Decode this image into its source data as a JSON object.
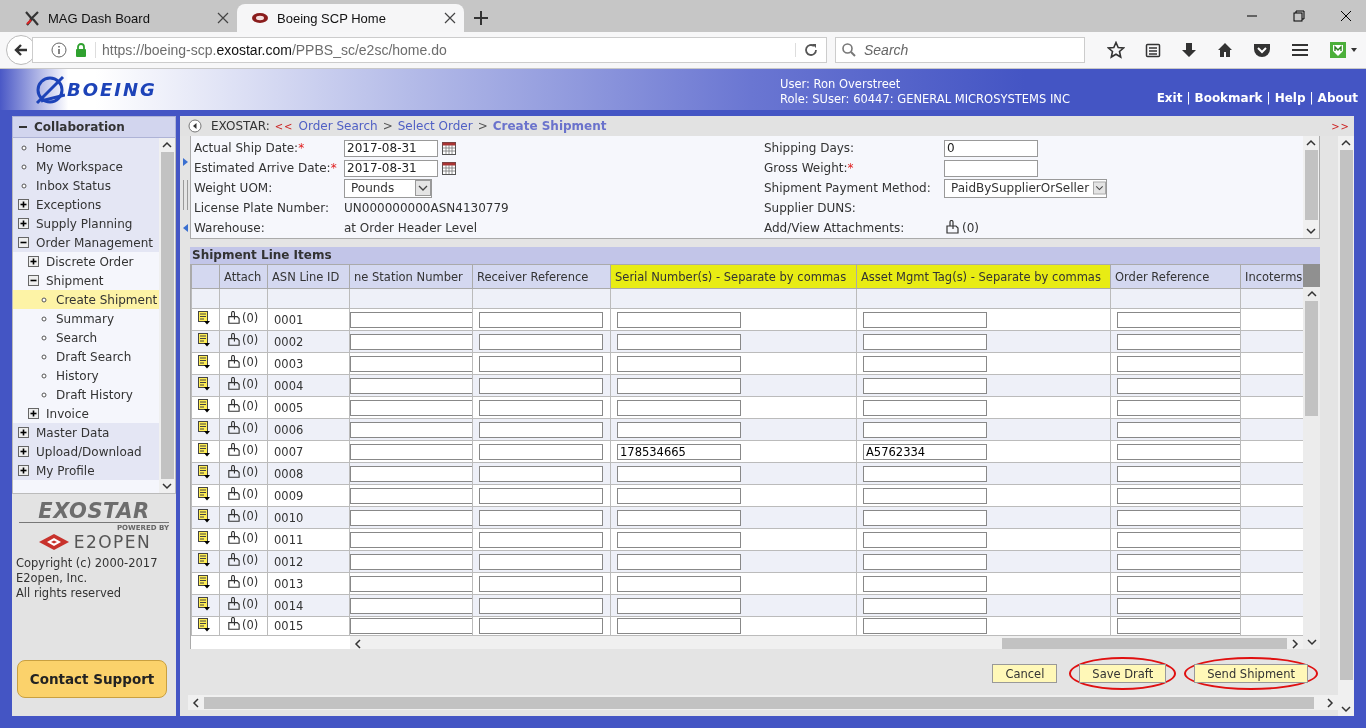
{
  "browser": {
    "tabs": [
      {
        "title": "MAG Dash Board",
        "selected": false
      },
      {
        "title": "Boeing SCP Home",
        "selected": true
      }
    ],
    "url": {
      "scheme_host": "https://boeing-scp.",
      "domain": "exostar.com",
      "path": "/PPBS_sc/e2sc/home.do"
    },
    "search": {
      "placeholder": "Search"
    }
  },
  "header": {
    "logo": "BOEING",
    "user": "User: Ron Overstreet",
    "role": "Role: SUser: 60447: GENERAL MICROSYSTEMS INC",
    "links": [
      {
        "kind": "link",
        "label": "Exit"
      },
      {
        "kind": "separator",
        "label": "|"
      },
      {
        "kind": "link",
        "label": "Bookmark"
      },
      {
        "kind": "separator",
        "label": "|"
      },
      {
        "kind": "link",
        "label": "Help"
      },
      {
        "kind": "separator",
        "label": "|"
      },
      {
        "kind": "link",
        "label": "About"
      }
    ]
  },
  "sidebar": {
    "title": "Collaboration",
    "expanded": true,
    "items": [
      {
        "label": "Home",
        "kind": "leaf",
        "selected": false
      },
      {
        "label": "My Workspace",
        "kind": "leaf",
        "selected": false
      },
      {
        "label": "Inbox Status",
        "kind": "leaf",
        "selected": false
      },
      {
        "label": "Exceptions",
        "kind": "folder",
        "expanded": false,
        "selected": false
      },
      {
        "label": "Supply Planning",
        "kind": "folder",
        "expanded": false,
        "selected": false
      },
      {
        "label": "Order Management",
        "kind": "folder",
        "expanded": true,
        "selected": false,
        "children": [
          {
            "label": "Discrete Order",
            "kind": "folder",
            "expanded": false,
            "selected": false
          },
          {
            "label": "Shipment",
            "kind": "folder",
            "expanded": true,
            "selected": false,
            "children": [
              {
                "label": "Create Shipment",
                "kind": "leaf",
                "selected": true
              },
              {
                "label": "Summary",
                "kind": "leaf",
                "selected": false
              },
              {
                "label": "Search",
                "kind": "leaf",
                "selected": false
              },
              {
                "label": "Draft Search",
                "kind": "leaf",
                "selected": false
              },
              {
                "label": "History",
                "kind": "leaf",
                "selected": false
              },
              {
                "label": "Draft History",
                "kind": "leaf",
                "selected": false
              }
            ]
          },
          {
            "label": "Invoice",
            "kind": "folder",
            "expanded": false,
            "selected": false
          }
        ]
      },
      {
        "label": "Master Data",
        "kind": "folder",
        "expanded": false,
        "selected": false
      },
      {
        "label": "Upload/Download",
        "kind": "folder",
        "expanded": false,
        "selected": false
      },
      {
        "label": "My Profile",
        "kind": "folder",
        "expanded": false,
        "selected": false
      }
    ],
    "brand": {
      "exostar": "EXOSTAR",
      "powered_by": "POWERED BY",
      "e2open": "E2OPEN"
    },
    "copyright": [
      "Copyright (c) 2000-2017",
      "E2open, Inc.",
      "All rights reserved"
    ],
    "contact_button": "Contact Support"
  },
  "breadcrumb": {
    "prefix": "EXOSTAR:",
    "back": "<<",
    "forward": ">>",
    "items": [
      {
        "kind": "link",
        "label": "Order Search"
      },
      {
        "kind": "separator",
        "label": ">"
      },
      {
        "kind": "link",
        "label": "Select Order"
      },
      {
        "kind": "separator",
        "label": ">"
      },
      {
        "kind": "current",
        "label": "Create Shipment"
      }
    ]
  },
  "form": {
    "left": [
      {
        "label": "Actual Ship Date:",
        "required_mark": "*",
        "kind": "date",
        "value": "2017-08-31"
      },
      {
        "label": "Estimated Arrive Date:",
        "required_mark": "*",
        "kind": "date",
        "value": "2017-08-31"
      },
      {
        "label": "Weight UOM:",
        "kind": "select",
        "value": "Pounds"
      },
      {
        "label": "License Plate Number:",
        "kind": "text",
        "value": "UN000000000ASN4130779"
      },
      {
        "label": "Warehouse:",
        "kind": "text",
        "value": "at Order Header Level"
      }
    ],
    "right": [
      {
        "label": "Shipping Days:",
        "kind": "input",
        "value": "0"
      },
      {
        "label": "Gross Weight:",
        "required_mark": "*",
        "kind": "input"
      },
      {
        "label": "Shipment Payment Method:",
        "kind": "select",
        "value": "PaidBySupplierOrSeller"
      },
      {
        "label": "Supplier DUNS:",
        "kind": "empty"
      },
      {
        "label": "Add/View Attachments:",
        "kind": "attachment",
        "value": "(0)"
      }
    ]
  },
  "line_items": {
    "title": "Shipment Line Items",
    "columns": [
      {
        "label": "Attach",
        "kind": "attach",
        "highlighted": false
      },
      {
        "label": "ASN Line ID",
        "kind": "line_id",
        "highlighted": false
      },
      {
        "label": "ne Station Number",
        "kind": "input",
        "highlighted": false
      },
      {
        "label": "Receiver Reference",
        "kind": "input",
        "highlighted": false
      },
      {
        "label": "Serial Number(s) - Separate by commas",
        "kind": "serial",
        "highlighted": true
      },
      {
        "label": "Asset Mgmt Tag(s) - Separate by commas",
        "kind": "asset",
        "highlighted": true
      },
      {
        "label": "Order Reference",
        "kind": "input",
        "highlighted": false
      },
      {
        "label": "Incoterms",
        "kind": "blank",
        "highlighted": false
      }
    ],
    "rows": [
      {
        "id": "0001",
        "attach": "(0)"
      },
      {
        "id": "0002",
        "attach": "(0)"
      },
      {
        "id": "0003",
        "attach": "(0)"
      },
      {
        "id": "0004",
        "attach": "(0)"
      },
      {
        "id": "0005",
        "attach": "(0)"
      },
      {
        "id": "0006",
        "attach": "(0)"
      },
      {
        "id": "0007",
        "attach": "(0)",
        "serial": "178534665",
        "asset": "A5762334"
      },
      {
        "id": "0008",
        "attach": "(0)"
      },
      {
        "id": "0009",
        "attach": "(0)"
      },
      {
        "id": "0010",
        "attach": "(0)"
      },
      {
        "id": "0011",
        "attach": "(0)"
      },
      {
        "id": "0012",
        "attach": "(0)"
      },
      {
        "id": "0013",
        "attach": "(0)"
      },
      {
        "id": "0014",
        "attach": "(0)"
      },
      {
        "id": "0015",
        "attach": "(0)"
      }
    ]
  },
  "buttons": [
    {
      "label": "Cancel",
      "circled": false
    },
    {
      "label": "Save Draft",
      "circled": true
    },
    {
      "label": "Send Shipment",
      "circled": true
    }
  ]
}
